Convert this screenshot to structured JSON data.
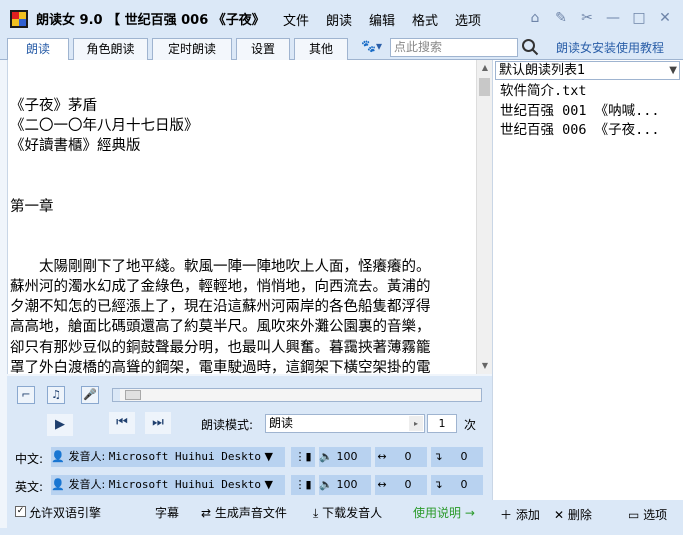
{
  "app": {
    "title": "朗读女 9.0 【 世纪百强 006 《子夜》",
    "menu": [
      "文件",
      "朗读",
      "编辑",
      "格式",
      "选项"
    ],
    "window_buttons": [
      "home-icon",
      "skin-icon",
      "pin-icon",
      "minimize-icon",
      "maximize-icon",
      "close-icon"
    ]
  },
  "tabs": [
    "朗读",
    "角色朗读",
    "定时朗读",
    "设置",
    "其他"
  ],
  "search": {
    "placeholder": "点此搜索"
  },
  "guide_link": "朗读女安装使用教程",
  "document": {
    "lines": [
      "《子夜》茅盾",
      "《二〇一〇年八月十七日版》",
      "《好讀書櫃》經典版",
      "",
      "",
      "第一章",
      "",
      "",
      "　　太陽剛剛下了地平綫。軟風一陣一陣地吹上人面，怪癢癢的。",
      "蘇州河的濁水幻成了金綠色，輕輕地，悄悄地，向西流去。黃浦的",
      "夕潮不知怎的已經漲上了，現在沿這蘇州河兩岸的各色船隻都浮得",
      "高高地，艙面比碼頭還高了約莫半尺。風吹來外灘公園裏的音樂，",
      "卻只有那炒豆似的銅鼓聲最分明，也最叫人興奮。暮靄挾著薄霧籠",
      "罩了外白渡橋的高聳的鋼架，電車駛過時，這鋼架下橫空架掛的電"
    ]
  },
  "playlist": {
    "selected": "默认朗读列表1",
    "items": [
      "软件简介.txt",
      "世纪百强 001 《呐喊...",
      "世纪百强 006 《子夜..."
    ]
  },
  "player": {
    "progress": 0.02,
    "mode_label": "朗读模式:",
    "mode_value": "朗读",
    "count": "1",
    "count_unit": "次"
  },
  "voices": {
    "zh": {
      "label": "中文:",
      "speaker_label": "发音人:",
      "speaker": "Microsoft Huihui Deskto",
      "volume": "100",
      "speed": "0",
      "pitch": "0"
    },
    "en": {
      "label": "英文:",
      "speaker_label": "发音人:",
      "speaker": "Microsoft Huihui Deskto",
      "volume": "100",
      "speed": "0",
      "pitch": "0"
    }
  },
  "bottom": {
    "allow_bilingual": "允许双语引擎",
    "subtitle": "字幕",
    "generate_audio": "生成声音文件",
    "download_voice": "下载发音人",
    "usage": "使用说明 →"
  },
  "list_tools": {
    "add": "添加",
    "delete": "删除",
    "options": "选项"
  },
  "colors": {
    "accent": "#2a5ea8",
    "panel": "#dbe8f7",
    "voice_box": "#b8d2f0"
  }
}
